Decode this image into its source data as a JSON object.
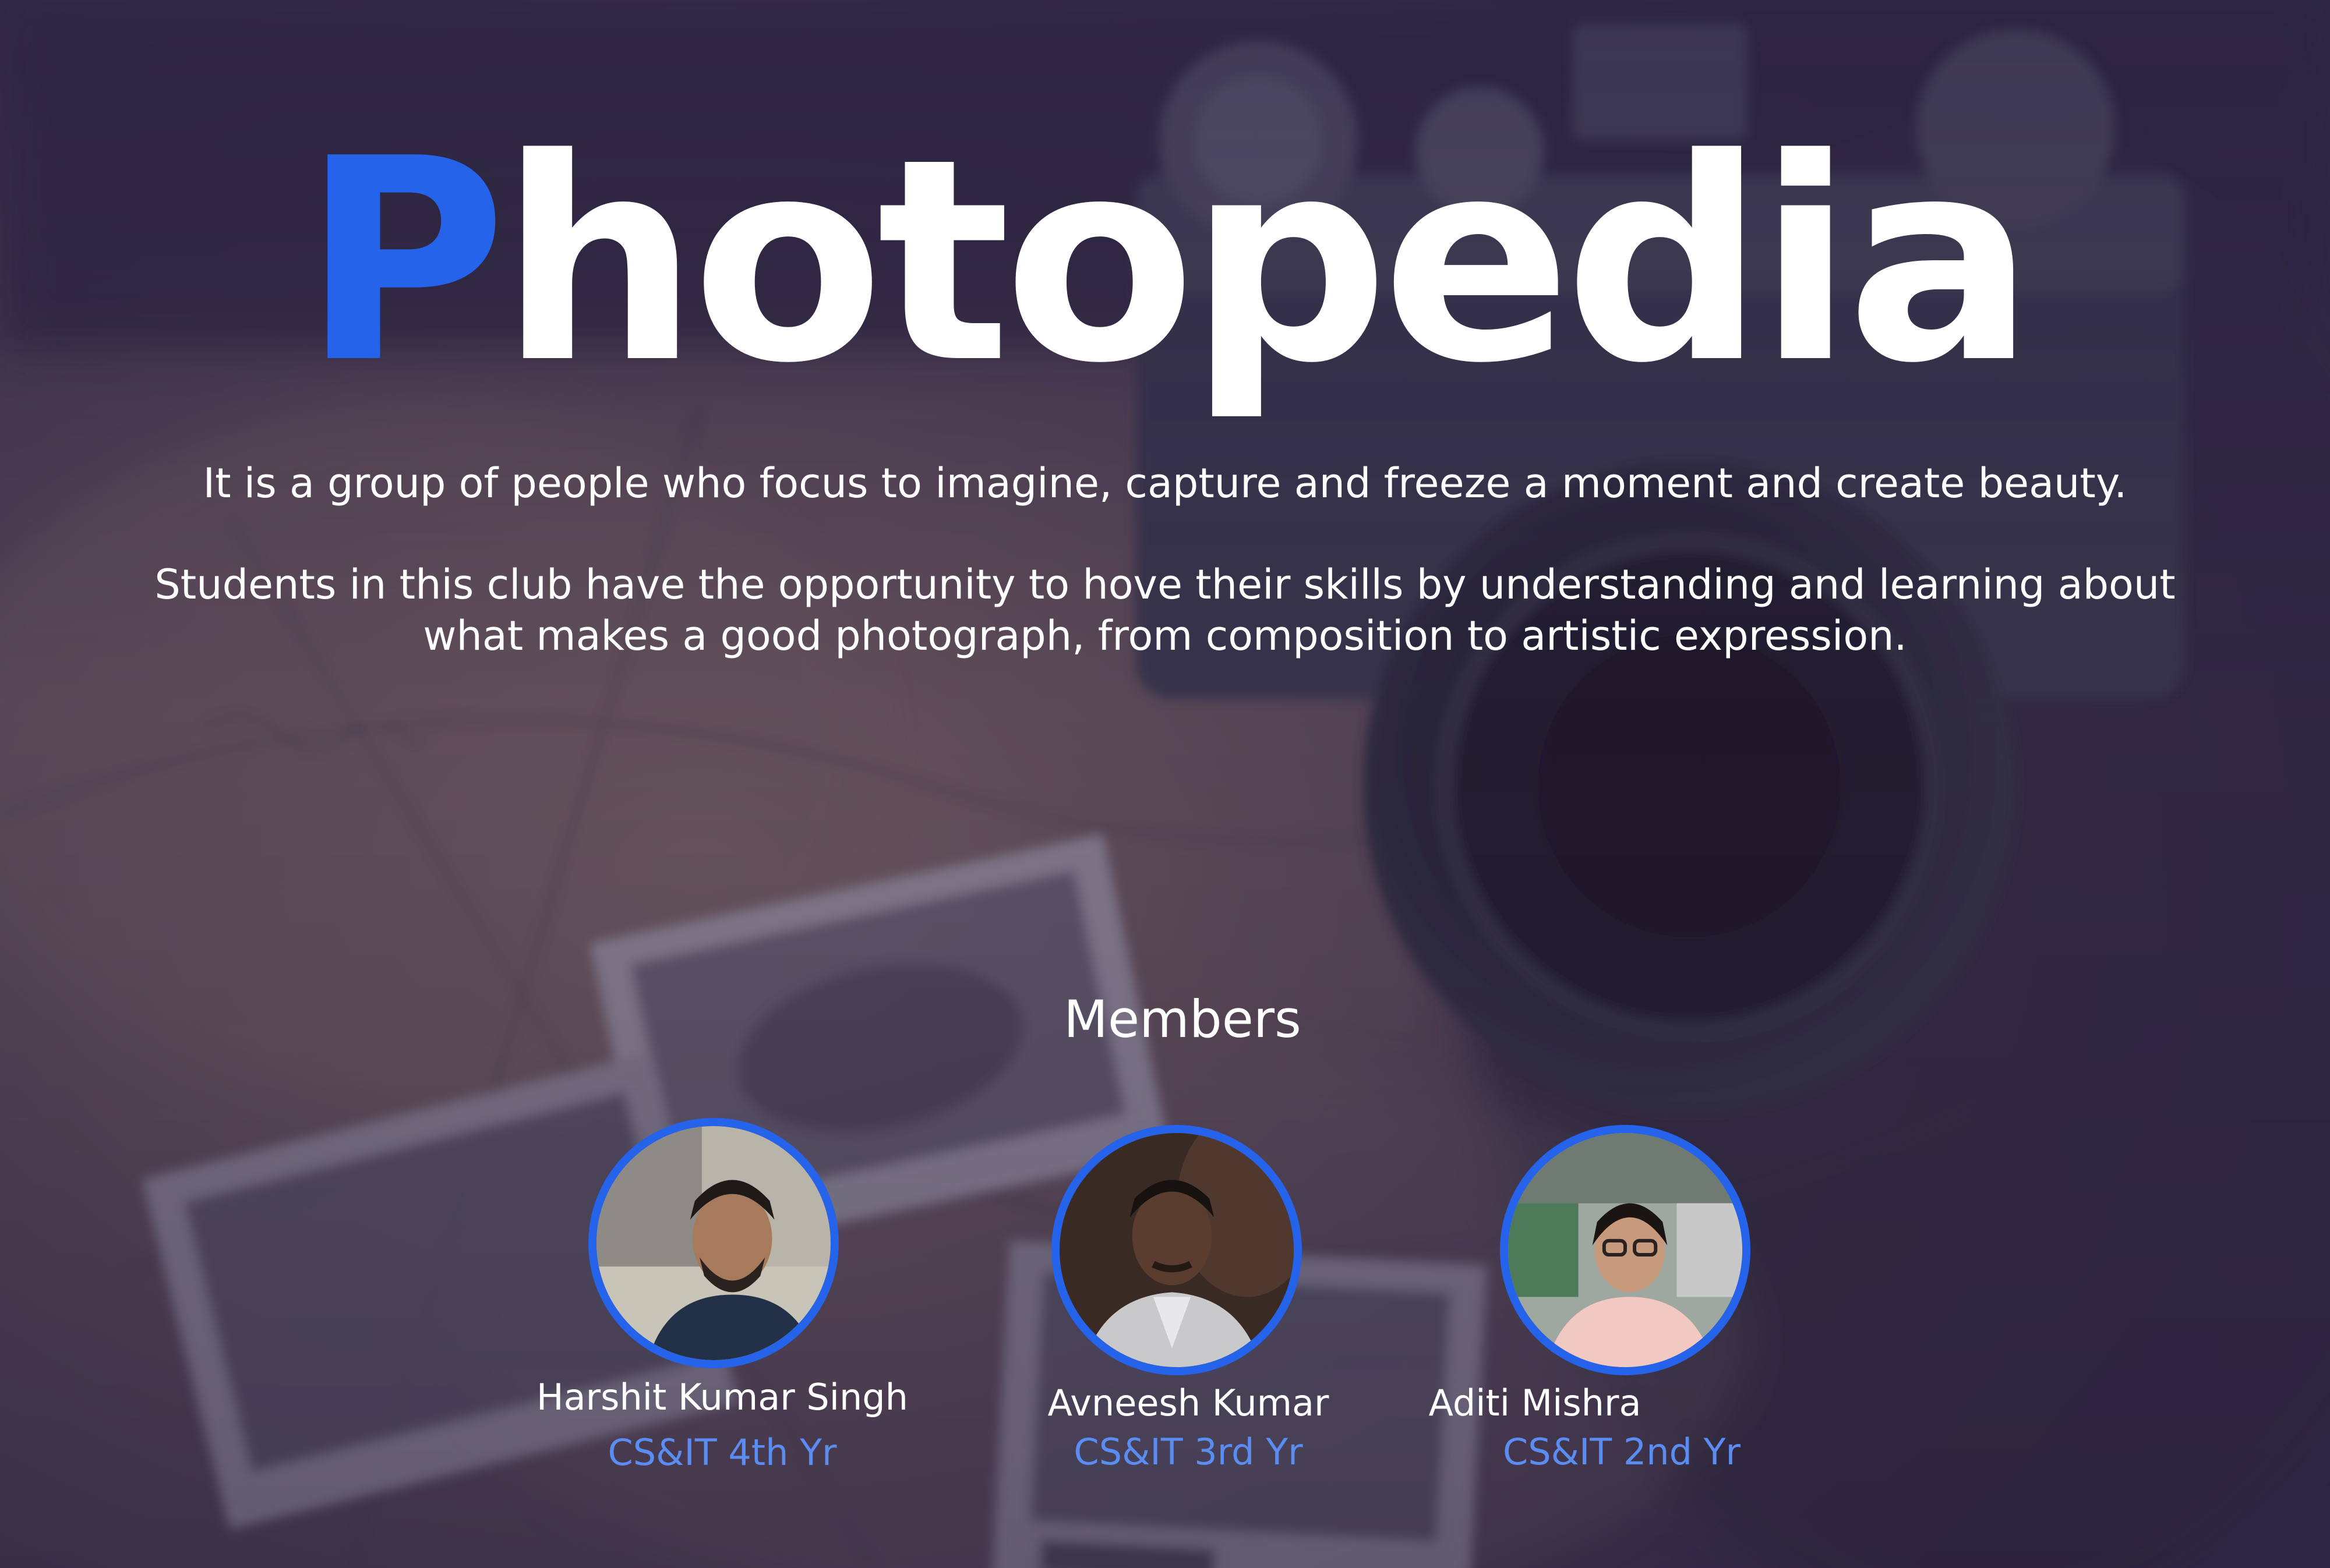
{
  "theme": {
    "accent": "#2563eb",
    "accent_light": "#5b8cf2"
  },
  "title": {
    "first_letter": "P",
    "rest": "hotopedia"
  },
  "intro": {
    "line1": "It is a group of people who focus to imagine, capture and freeze a moment and create beauty.",
    "line2": "Students in this club have the opportunity to hove their skills by understanding and learning about what makes a good photograph, from composition to artistic expression."
  },
  "members": {
    "heading": "Members",
    "list": [
      {
        "name": "Harshit Kumar Singh",
        "role": "CS&IT 4th Yr",
        "photo": "member-photo"
      },
      {
        "name": "Avneesh Kumar",
        "role": "CS&IT 3rd Yr",
        "photo": "member-photo"
      },
      {
        "name": "Aditi Mishra",
        "role": "CS&IT 2nd Yr",
        "photo": "member-photo"
      }
    ]
  }
}
